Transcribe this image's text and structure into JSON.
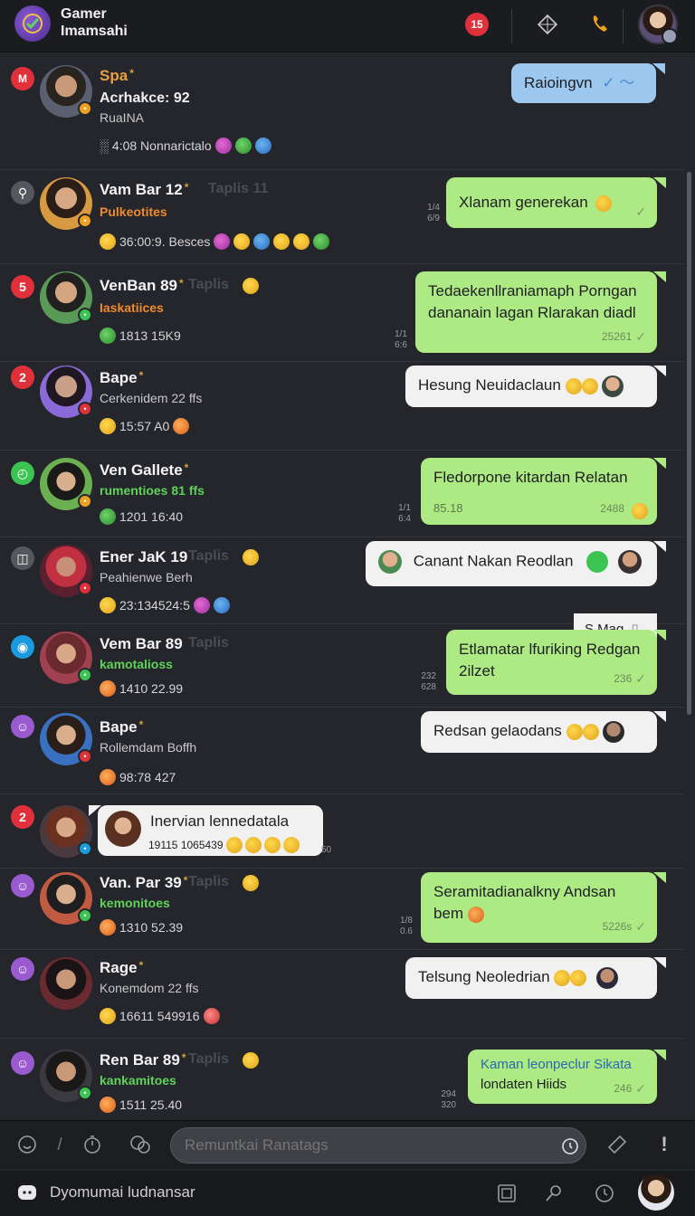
{
  "header": {
    "title": "Gamer Imamsahi",
    "badge": "15"
  },
  "colors": {
    "bubble_green": "#aeea84",
    "bubble_blue": "#9cc7ee",
    "bubble_white": "#f1f1f1",
    "background": "#24262b",
    "status_red": "#e0303a",
    "status_green": "#3cc452",
    "status_blue": "#1a9be0",
    "status_purple": "#9a5ad0",
    "status_gray": "#55575d"
  },
  "chats": [
    {
      "name": "Spa",
      "tag": "",
      "sub": "Acrhakce: 92",
      "sub2": "RuaINA",
      "meta": "4:08 Nonnarictalo",
      "status": "M",
      "bubble": "Raioingvn",
      "bubble_time": "",
      "side_time": ""
    },
    {
      "name": "Vam Bar 12",
      "tag": "Taplis 11",
      "sub": "Pulkeotites",
      "meta": "36:00:9. Besces",
      "status": "",
      "bubble": "Xlanam generekan",
      "bubble_time": "",
      "side_time": "1/4 6/9"
    },
    {
      "name": "VenBan 89",
      "tag": "Taplis",
      "sub": "Iaskatiices",
      "meta": "1813  15K9",
      "status": "5",
      "bubble": "Tedaekenllraniamaph Porngan dananain lagan Rlarakan diadl",
      "bubble_time": "25261",
      "side_time": "1/1 6:6"
    },
    {
      "name": "Bape",
      "tag": "",
      "sub": "Cerkenidem 22 ffs",
      "meta": "15:57  A0",
      "status": "2",
      "bubble": "Hesung Neuidaclaun",
      "bubble_time": "",
      "side_time": ""
    },
    {
      "name": "Ven Gallete",
      "tag": "",
      "sub": "rumentioes  81 ffs",
      "meta": "1201  16:40",
      "status": "",
      "bubble": "Fledorpone kitardan Relatan",
      "bubble_time": "2488",
      "bubble_left_time": "85.18",
      "side_time": "1/1 6:4"
    },
    {
      "name": "Ener JaK 19",
      "tag": "Taplis",
      "sub": "Peahienwe Berh",
      "meta": "23:134524:5",
      "status": "",
      "bubble": "Canant Nakan Reodlan",
      "bubble2": "S Mag",
      "bubble_time": "",
      "side_time": ""
    },
    {
      "name": "Vem Bar 89",
      "tag": "Taplis",
      "sub": "kamotalioss",
      "meta": "1410  22.99",
      "status": "",
      "bubble": "Etlamatar lfuriking Redgan 2ilzet",
      "bubble_time": "236",
      "side_time": "232 628"
    },
    {
      "name": "Bape",
      "tag": "",
      "sub": "Rollemdam Boffh",
      "meta": "98:78  427",
      "status": "",
      "bubble": "Redsan gelaodans",
      "bubble_time": "",
      "side_time": ""
    },
    {
      "name": "",
      "tag": "",
      "sub": "",
      "meta": "",
      "status": "2",
      "bubble": "Inervian lennedatala",
      "bubble_sub": "19115 1065439",
      "bubble_time": "",
      "side_time": "50"
    },
    {
      "name": "Van. Par 39",
      "tag": "Taplis",
      "sub": "kemonitoes",
      "meta": "1310  52.39",
      "status": "",
      "bubble": "Seramitadianalkny Andsan bem",
      "bubble_time": "5226s",
      "side_time": "1/8 0.6"
    },
    {
      "name": "Rage",
      "tag": "",
      "sub": "Konemdom 22 ffs",
      "meta": "16611  549916",
      "status": "",
      "bubble": "Telsung Neoledrian",
      "bubble_time": "",
      "side_time": ""
    },
    {
      "name": "Ren Bar 89",
      "tag": "Taplis",
      "sub": "kankamitoes",
      "meta": "1511  25.40",
      "status": "",
      "bubble": "Kaman leonpeclur Sikata",
      "bubble_line2": "londaten Hiids",
      "bubble_time": "246",
      "side_time": "294 320"
    }
  ],
  "composer": {
    "placeholder": "Remuntkai Ranatags"
  },
  "bottombar": {
    "text": "Dyomumai ludnansar"
  }
}
